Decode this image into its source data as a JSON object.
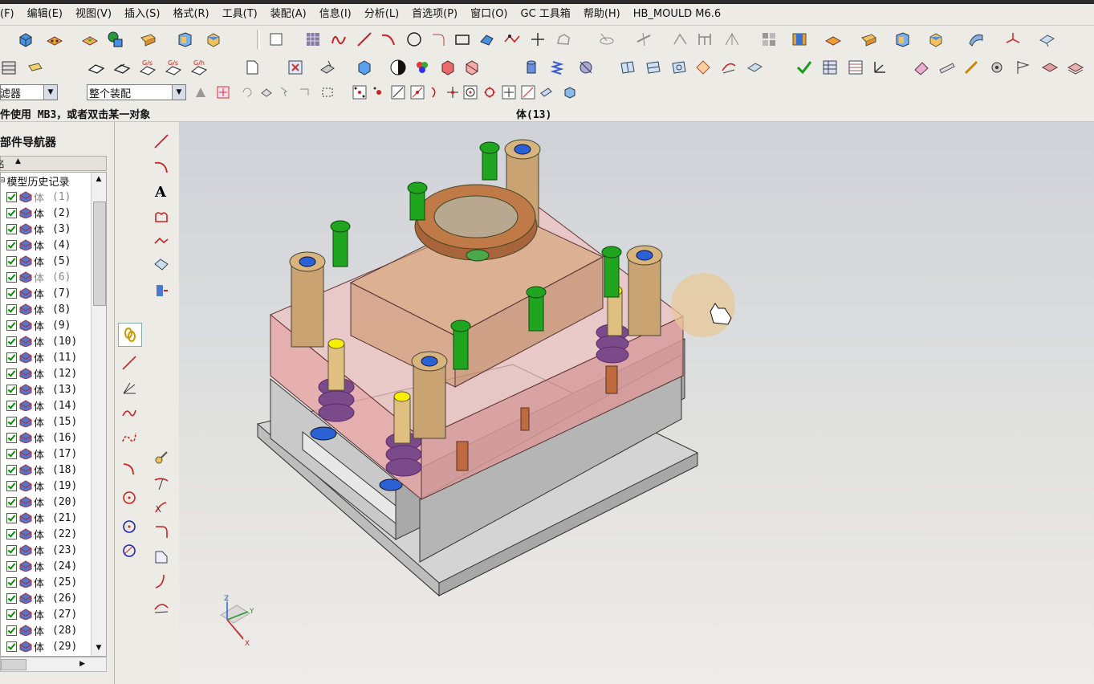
{
  "menubar": {
    "items": [
      "文件(F)",
      "编辑(E)",
      "视图(V)",
      "插入(S)",
      "格式(R)",
      "工具(T)",
      "装配(A)",
      "信息(I)",
      "分析(L)",
      "首选项(P)",
      "窗口(O)",
      "GC 工具箱",
      "帮助(H)",
      "HB_MOULD M6.6"
    ]
  },
  "toolbar3": {
    "filter_label": "过滤器",
    "scope_value": "整个装配"
  },
  "status": {
    "prompt": "件使用 MB3，或者双击某一对象",
    "selection": "体(13)"
  },
  "navigator": {
    "title": "部件导航器",
    "header_col": "名",
    "root_label": "模型历史记录",
    "row_label": "体",
    "rows": [
      {
        "num": "(1)",
        "dim": true
      },
      {
        "num": "(2)",
        "dim": false
      },
      {
        "num": "(3)",
        "dim": false
      },
      {
        "num": "(4)",
        "dim": false
      },
      {
        "num": "(5)",
        "dim": false
      },
      {
        "num": "(6)",
        "dim": true
      },
      {
        "num": "(7)",
        "dim": false
      },
      {
        "num": "(8)",
        "dim": false
      },
      {
        "num": "(9)",
        "dim": false
      },
      {
        "num": "(10)",
        "dim": false
      },
      {
        "num": "(11)",
        "dim": false
      },
      {
        "num": "(12)",
        "dim": false
      },
      {
        "num": "(13)",
        "dim": false
      },
      {
        "num": "(14)",
        "dim": false
      },
      {
        "num": "(15)",
        "dim": false
      },
      {
        "num": "(16)",
        "dim": false
      },
      {
        "num": "(17)",
        "dim": false
      },
      {
        "num": "(18)",
        "dim": false
      },
      {
        "num": "(19)",
        "dim": false
      },
      {
        "num": "(20)",
        "dim": false
      },
      {
        "num": "(21)",
        "dim": false
      },
      {
        "num": "(22)",
        "dim": false
      },
      {
        "num": "(23)",
        "dim": false
      },
      {
        "num": "(24)",
        "dim": false
      },
      {
        "num": "(25)",
        "dim": false
      },
      {
        "num": "(26)",
        "dim": false
      },
      {
        "num": "(27)",
        "dim": false
      },
      {
        "num": "(28)",
        "dim": false
      },
      {
        "num": "(29)",
        "dim": false
      }
    ]
  },
  "triad": {
    "x": "X",
    "y": "Y",
    "z": "Z"
  },
  "colors": {
    "mold_pink": "#e8a8a8",
    "plate_gray": "#c9c9c9",
    "cap_green": "#1fa51f",
    "bushing_tan": "#c9a472",
    "ring_brown": "#a8643a",
    "spring_purple": "#7a4a8a",
    "accent_blue": "#2a62d6"
  }
}
